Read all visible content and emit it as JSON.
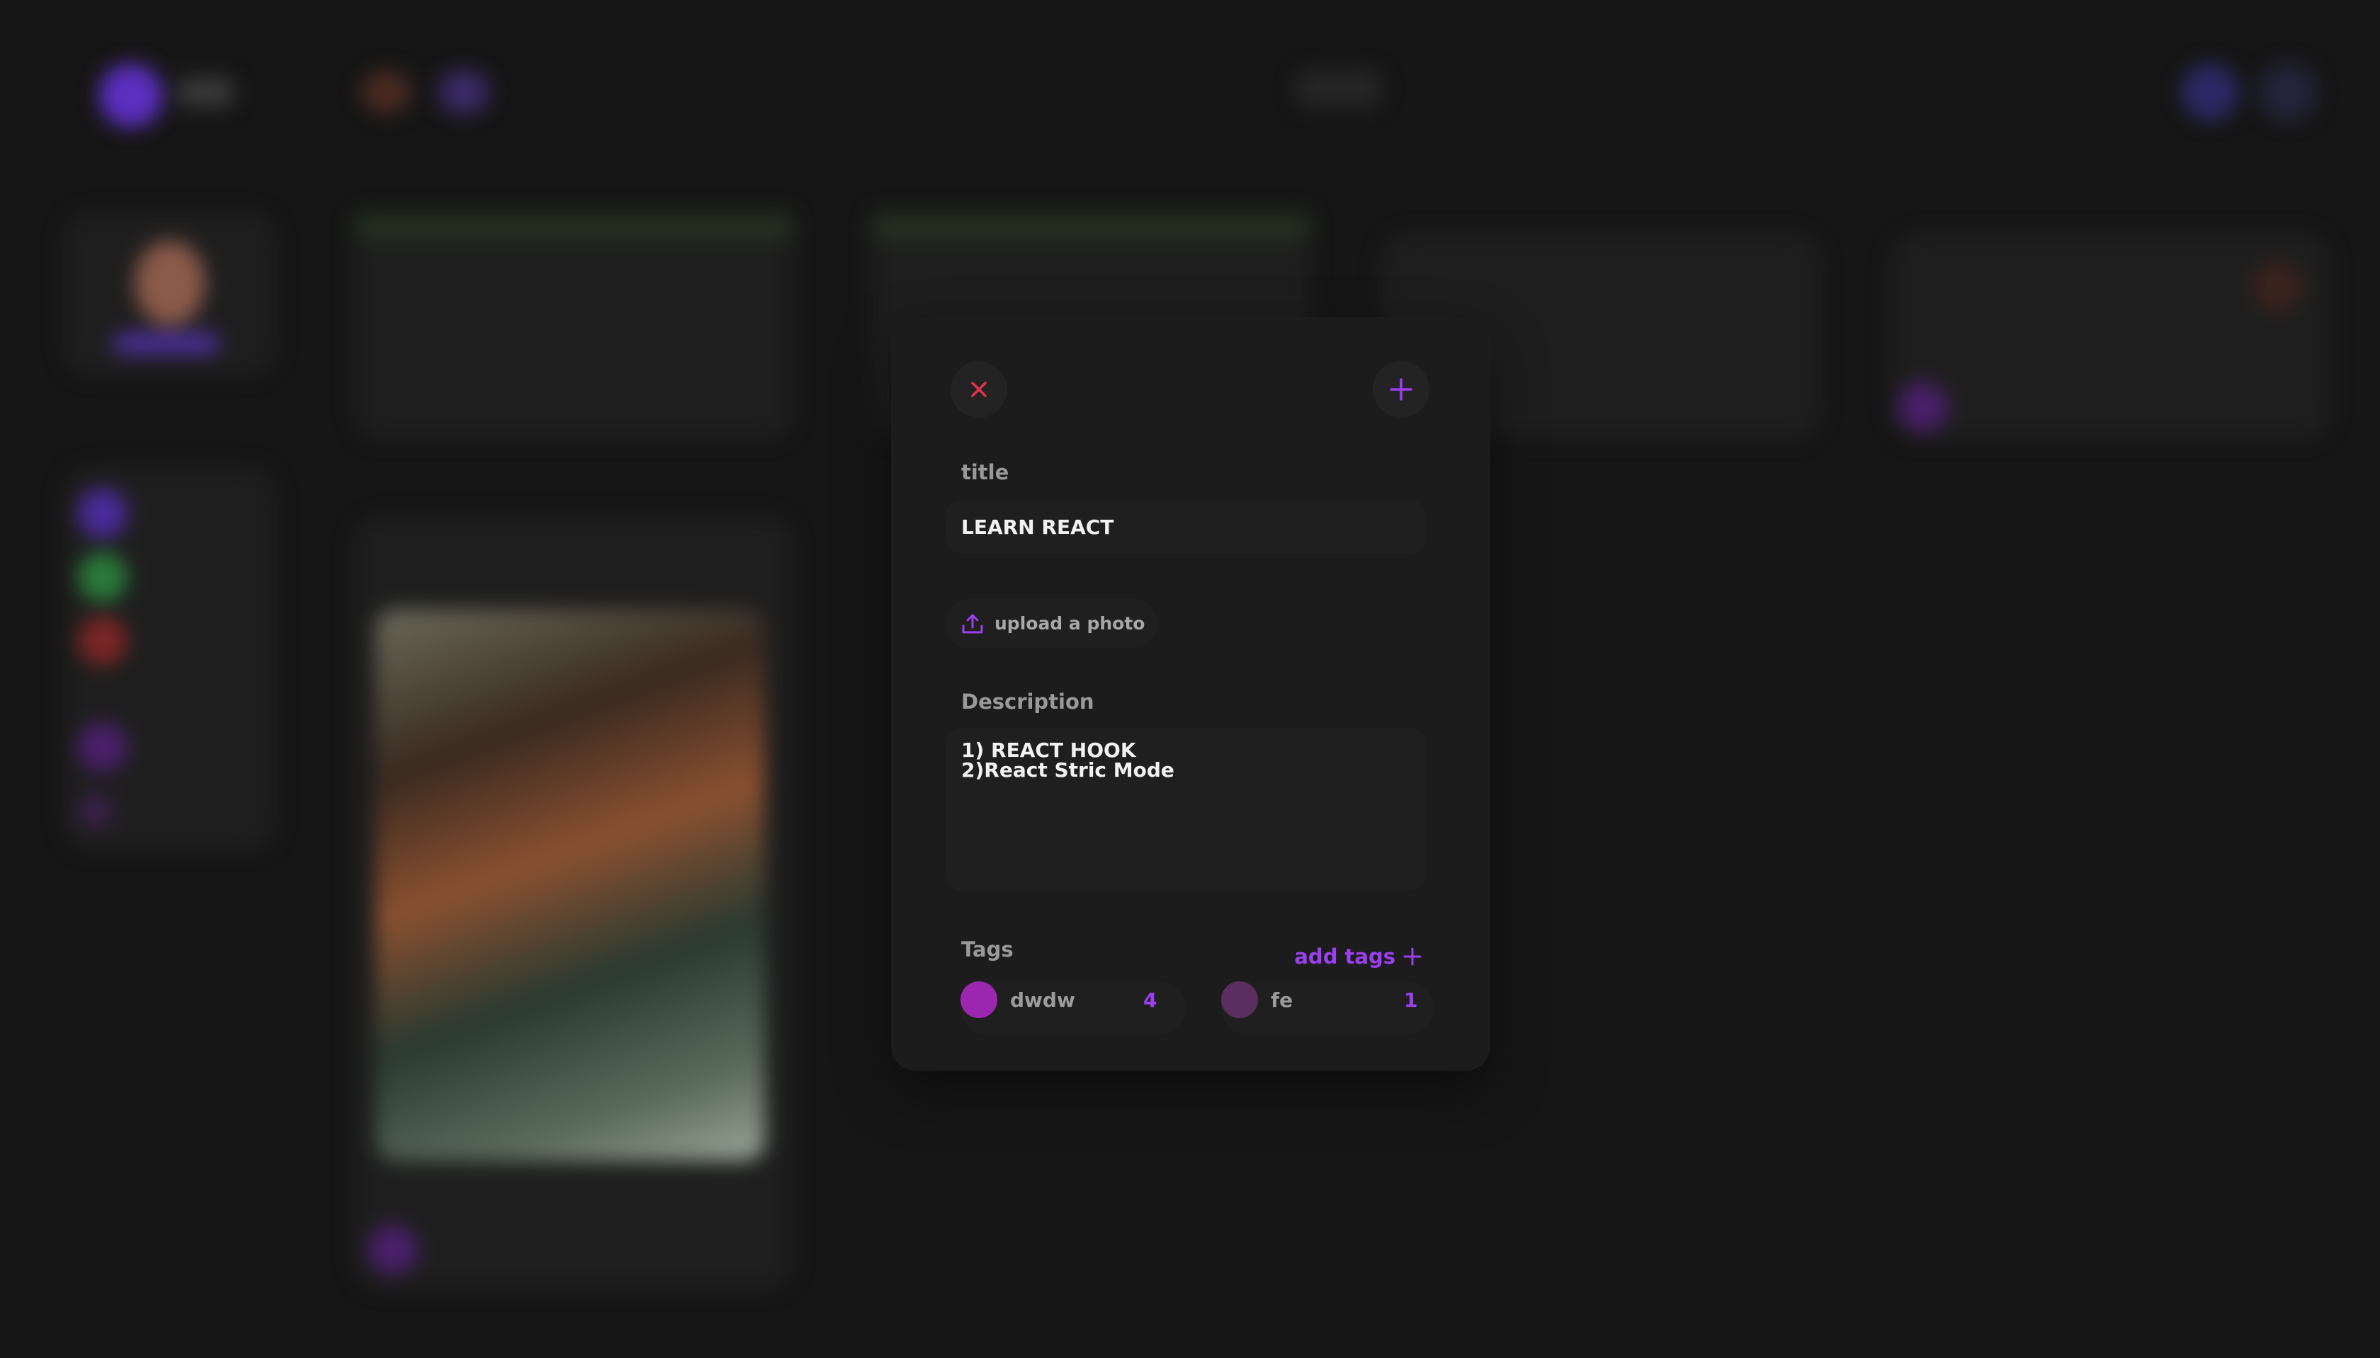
{
  "modal": {
    "close_icon": "close-icon",
    "add_icon": "plus-icon",
    "title_label": "title",
    "title_value": "LEARN REACT",
    "upload_label": "upload a photo",
    "upload_icon": "upload-icon",
    "description_label": "Description",
    "description_value": "1) REACT HOOK\n2)React Stric Mode",
    "tags_label": "Tags",
    "add_tags_label": "add tags",
    "tags": [
      {
        "name": "dwdw",
        "count": "4",
        "color": "#9b27b0"
      },
      {
        "name": "fe",
        "count": "1",
        "color": "#5a2e5f"
      }
    ]
  },
  "colors": {
    "accent": "#9b3ff0",
    "close": "#e0344a",
    "background": "#161616",
    "modal": "#1c1c1c"
  }
}
